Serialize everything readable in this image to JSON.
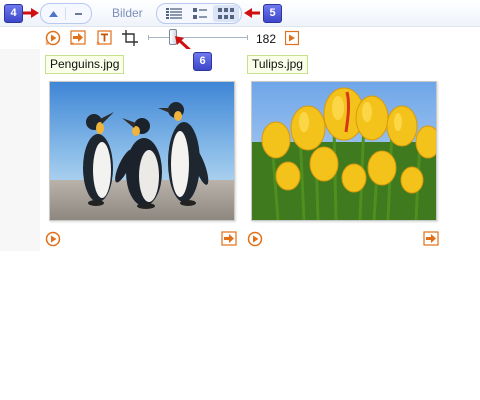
{
  "header": {
    "title": "Bilder",
    "callouts": {
      "nav": "4",
      "view": "5",
      "slider": "6"
    },
    "nav_buttons": [
      {
        "name": "collapse-up-icon"
      },
      {
        "name": "minus-icon"
      }
    ],
    "view_buttons": [
      {
        "name": "details-view-icon",
        "active": false
      },
      {
        "name": "list-view-icon",
        "active": false
      },
      {
        "name": "thumbnail-view-icon",
        "active": true
      }
    ]
  },
  "toolbar": {
    "buttons": [
      "play-icon",
      "export-icon",
      "rename-icon",
      "crop-icon"
    ],
    "slider": {
      "value": "182",
      "position": 0.25
    },
    "next_icon": "next-arrow-icon"
  },
  "images": [
    {
      "filename": "Penguins.jpg",
      "thumbnail": "penguins-image"
    },
    {
      "filename": "Tulips.jpg",
      "thumbnail": "tulips-image"
    }
  ],
  "colors": {
    "accent_orange": "#e0701a",
    "callout_badge": "#4a54d8",
    "callout_arrow": "#d01010",
    "label_bg": "#f9ffe9",
    "label_border": "#c6e08e"
  }
}
